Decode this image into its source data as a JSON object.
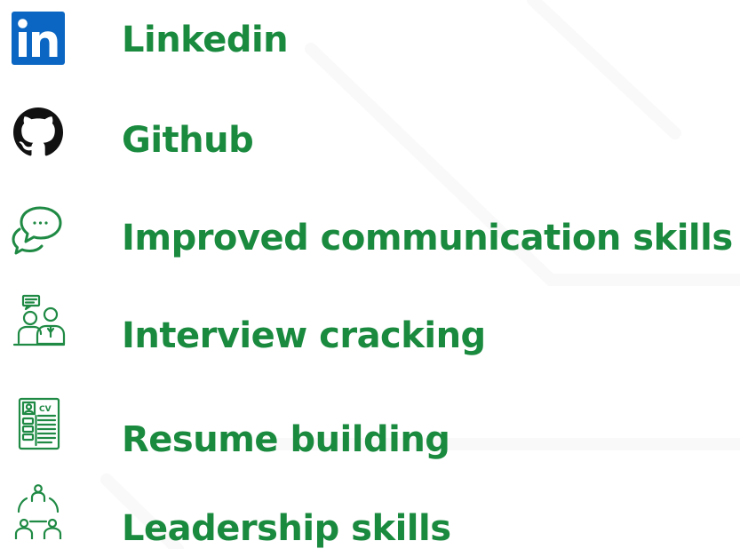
{
  "colors": {
    "label_green": "#1a8a3f",
    "icon_green": "#1f8a44",
    "linkedin_blue": "#0a66c2",
    "github_black": "#111111"
  },
  "items": [
    {
      "label": "Linkedin",
      "icon": "linkedin-icon"
    },
    {
      "label": "Github",
      "icon": "github-icon"
    },
    {
      "label": "Improved communication skills",
      "icon": "chat-bubbles-icon"
    },
    {
      "label": "Interview cracking",
      "icon": "interview-icon"
    },
    {
      "label": "Resume building",
      "icon": "resume-cv-icon"
    },
    {
      "label": "Leadership skills",
      "icon": "leadership-team-icon"
    }
  ]
}
